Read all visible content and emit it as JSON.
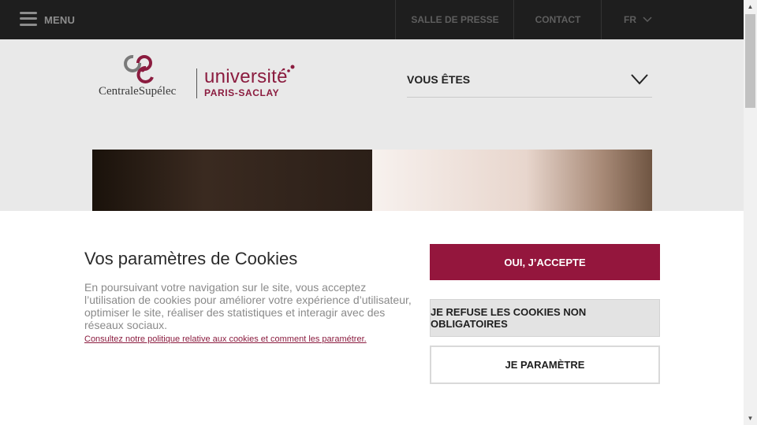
{
  "topbar": {
    "menu_label": "MENU",
    "links": [
      {
        "label": "SALLE DE PRESSE"
      },
      {
        "label": "CONTACT"
      }
    ],
    "language": "FR"
  },
  "logo": {
    "centralesupelec": "CentraleSupélec",
    "universite": "université",
    "paris_saclay": "PARIS-SACLAY"
  },
  "vous_etes": {
    "label": "VOUS ÊTES"
  },
  "cookie": {
    "title": "Vos paramètres de Cookies",
    "text": "En poursuivant votre navigation sur le site, vous acceptez l’utilisation de cookies pour améliorer votre expérience d’utilisateur, optimiser le site, réaliser des statistiques et interagir avec des réseaux sociaux.",
    "link": "Consultez notre politique relative aux cookies et comment les paramétrer.",
    "accept_label": "OUI, J’ACCEPTE",
    "refuse_label": "JE REFUSE LES COOKIES NON OBLIGATOIRES",
    "settings_label": "JE PARAMÈTRE"
  },
  "colors": {
    "brand": "#94163d",
    "topbar": "#1e1e1e"
  },
  "scrollbar": {
    "up_glyph": "▲",
    "down_glyph": "▼"
  }
}
